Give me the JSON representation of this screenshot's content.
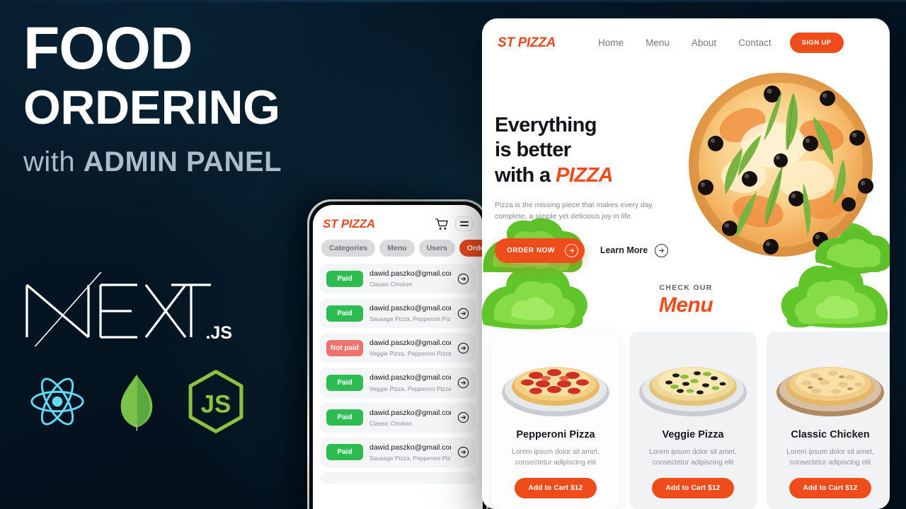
{
  "theme": {
    "bg_dark": "#041320",
    "accent_orange": "#ef4c1b",
    "logo_orange": "#e8491f",
    "paid_green": "#2cbc52",
    "notpaid_red": "#f0726f",
    "subtitle_blue_grey": "#a9bdcc"
  },
  "headline": {
    "line1": "FOOD",
    "line2": "ORDERING",
    "line3_prefix": "with ",
    "line3_main": "ADMIN PANEL"
  },
  "tech": {
    "next_label": "NEXT",
    "next_suffix": ".JS",
    "icons": [
      {
        "name": "react-icon",
        "label": "React"
      },
      {
        "name": "mongodb-icon",
        "label": "MongoDB"
      },
      {
        "name": "nodejs-icon",
        "label": "Node.js"
      }
    ]
  },
  "phone": {
    "logo": "ST PIZZA",
    "icons": [
      {
        "name": "cart-icon"
      },
      {
        "name": "hamburger-menu-icon"
      }
    ],
    "tabs": [
      {
        "label": "Categories",
        "active": false
      },
      {
        "label": "Menu",
        "active": false
      },
      {
        "label": "Users",
        "active": false
      },
      {
        "label": "Orders",
        "active": true
      }
    ],
    "orders": [
      {
        "status": "Paid",
        "paid": true,
        "email": "dawid.paszko@gmail.com",
        "items": "Classic Chicken"
      },
      {
        "status": "Paid",
        "paid": true,
        "email": "dawid.paszko@gmail.com",
        "items": "Sausage Pizza, Pepperoni Pizza"
      },
      {
        "status": "Not paid",
        "paid": false,
        "email": "dawid.paszko@gmail.com",
        "items": "Veggie Pizza, Pepperoni Pizza"
      },
      {
        "status": "Paid",
        "paid": true,
        "email": "dawid.paszko@gmail.com",
        "items": "Veggie Pizza, Pepperoni Pizza"
      },
      {
        "status": "Paid",
        "paid": true,
        "email": "dawid.paszko@gmail.com",
        "items": "Classic Chicken"
      },
      {
        "status": "Paid",
        "paid": true,
        "email": "dawid.paszko@gmail.com",
        "items": "Sausage Pizza, Pepperoni Pizza"
      }
    ]
  },
  "web": {
    "logo": "ST PIZZA",
    "nav_links": [
      "Home",
      "Menu",
      "About",
      "Contact"
    ],
    "signup_label": "SIGN UP",
    "hero": {
      "title_line1": "Everything",
      "title_line2": "is better",
      "title_line3_prefix": "with a ",
      "title_line3_accent": "PIZZA",
      "subtitle": "Pizza is the missing piece that makes every day complete, a simple yet delicious joy in life.",
      "primary_button": "ORDER NOW",
      "secondary_button": "Learn More"
    },
    "menu_section": {
      "eyebrow": "CHECK OUR",
      "title": "Menu"
    },
    "products": [
      {
        "name": "Pepperoni Pizza",
        "description": "Lorem ipsum dolor sit amet, consectetur adipiscing elit",
        "button": "Add to Cart $12",
        "price": "$12"
      },
      {
        "name": "Veggie Pizza",
        "description": "Lorem ipsum dolor sit amet, consectetur adipiscing elit",
        "button": "Add to Cart $12",
        "price": "$12"
      },
      {
        "name": "Classic Chicken",
        "description": "Lorem ipsum dolor sit amet, consectetur adipiscing elit",
        "button": "Add to Cart $12",
        "price": "$12"
      }
    ]
  }
}
